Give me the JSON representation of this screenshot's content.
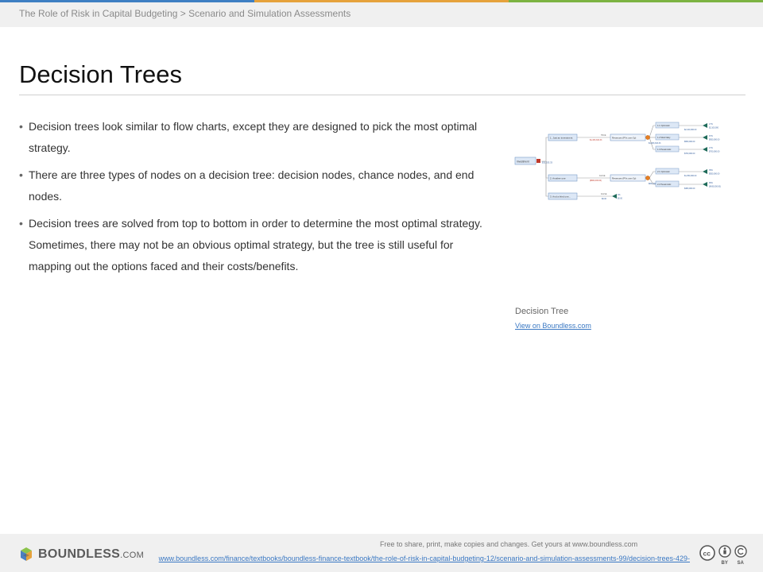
{
  "header": {
    "breadcrumb": "The Role of Risk in Capital Budgeting > Scenario and Simulation Assessments",
    "stripe_colors": [
      "#3e7fc3",
      "#e6a23c",
      "#7cb342"
    ]
  },
  "main": {
    "title": "Decision Trees",
    "bullets": [
      "Decision trees look similar to flow charts, except they are designed to pick the most optimal strategy.",
      "There are three types of nodes on a decision tree: decision nodes, chance nodes, and end nodes.",
      "Decision trees are solved from top to bottom in order to determine the most optimal strategy.  Sometimes, there may not be an obvious optimal strategy, but the tree is still useful for mapping out the options faced and their costs/benefits."
    ]
  },
  "figure": {
    "caption": "Decision Tree",
    "link": "View on Boundless.com",
    "tree": {
      "root": "Investment",
      "root_value": "$31,333.33",
      "branches": [
        {
          "label": "1. Just an investment",
          "flag": "TRUE",
          "value": "$1,333,333.33",
          "node": "Revenues (PVs over 3y)",
          "node_value": "$1,333,333.33"
        },
        {
          "label": "2. Another one",
          "flag": "FALSE",
          "value": "($800,000.00)",
          "node": "Revenues (PVs over 3y)",
          "node_value": "$841,500.00"
        },
        {
          "label": "3. And a third one...",
          "flag": "FALSE",
          "value": "$0.00",
          "end_prob": "0%",
          "end_value": "$0.00"
        }
      ],
      "outcomes": [
        {
          "label": "1.1 Optimistic",
          "value": "$2,100,000.00",
          "prob": "17%",
          "pay": "$2,100,000"
        },
        {
          "label": "1.2 Most likely",
          "value": "$950,000.00",
          "prob": "67%",
          "pay": "$950,000.00"
        },
        {
          "label": "1.3 Pessimistic",
          "value": "$700,000.00",
          "prob": "17%",
          "pay": "$700,000.00"
        },
        {
          "label": "2.1 Optimistic",
          "value": "$1,350,000.00",
          "prob": "35%",
          "pay": "$550,000.00"
        },
        {
          "label": "2.2 Pessimistic",
          "value": "$380,000.00",
          "prob": "65%",
          "pay": "($420,000.00)"
        }
      ]
    }
  },
  "footer": {
    "brand": "BOUNDLESS",
    "brand_suffix": ".COM",
    "share_text": "Free to share, print, make copies and changes. Get yours at www.boundless.com",
    "url": "www.boundless.com/finance/textbooks/boundless-finance-textbook/the-role-of-risk-in-capital-budgeting-12/scenario-and-simulation-assessments-99/decision-trees-429-",
    "license": [
      "cc",
      "BY",
      "SA"
    ]
  }
}
